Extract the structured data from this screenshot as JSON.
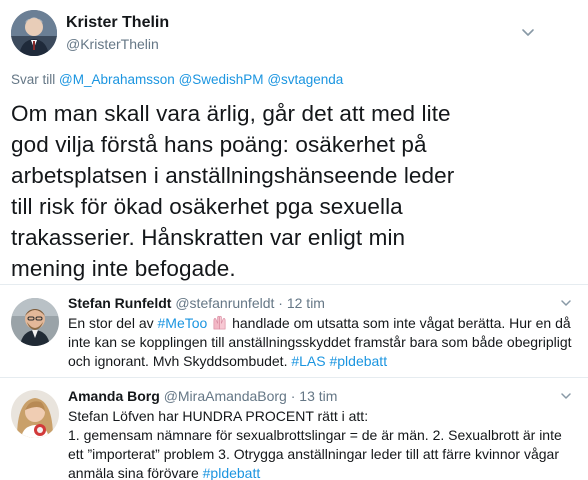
{
  "main_tweet": {
    "author_name": "Krister Thelin",
    "author_handle": "@KristerThelin",
    "reply_prefix": "Svar till",
    "reply_to": [
      "@M_Abrahamsson",
      "@SwedishPM",
      "@svtagenda"
    ],
    "text": "Om man skall vara ärlig, går det att med lite god vilja förstå hans poäng: osäkerhet på arbetsplatsen i anställningshänseende leder till risk för ökad osäkerhet pga sexuella trakasserier. Hånskratten var enligt min mening inte befogade.",
    "avatar_icon": "profile-photo"
  },
  "replies": [
    {
      "author_name": "Stefan Runfeldt",
      "author_handle": "@stefanrunfeldt",
      "separator": "·",
      "time": "12 tim",
      "text_1": "En stor del av ",
      "hashtag_1": "#MeToo",
      "emoji": "raised-hands",
      "text_2": " handlade om utsatta som inte vågat berätta. Hur en då inte kan se kopplingen till anställningsskyddet framstår bara som både obegripligt och ignorant. Mvh Skyddsombudet. ",
      "hashtag_2": "#LAS",
      "hashtag_3": "#pldebatt"
    },
    {
      "author_name": "Amanda Borg",
      "author_handle": "@MiraAmandaBorg",
      "separator": "·",
      "time": "13 tim",
      "line_1": "Stefan Löfven har HUNDRA PROCENT rätt i att:",
      "line_2": "1. gemensam nämnare för sexualbrottslingar = de är män. 2. Sexualbrott är inte ett ”importerat” problem 3. Otrygga anställningar leder till att färre kvinnor vågar anmäla sina förövare ",
      "hashtag": "#pldebatt"
    }
  ],
  "colors": {
    "link": "#1b95e0",
    "muted": "#657786",
    "text": "#14171a",
    "divider": "#e6ecf0"
  }
}
